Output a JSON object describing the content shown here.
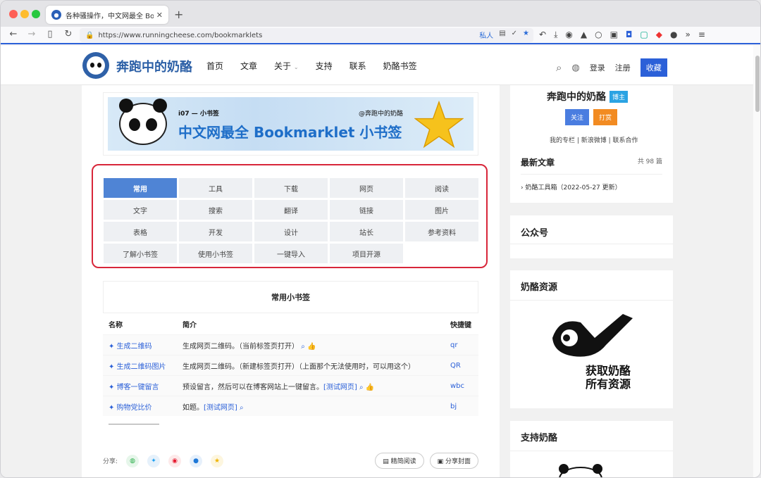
{
  "browser": {
    "tab_title": "各种骚操作，中文网最全 Bookmarklet",
    "url": "https://www.runningcheese.com/bookmarklets",
    "url_private": "私人",
    "accent": "#2b60d8"
  },
  "header": {
    "site_name": "奔跑中的奶酪",
    "menu": [
      "首页",
      "文章",
      "关于",
      "支持",
      "联系",
      "奶酪书签"
    ],
    "login": "登录",
    "register": "注册",
    "favorite": "收藏"
  },
  "banner": {
    "subtitle": "i07 — 小书签",
    "at": "@奔跑中的奶酪",
    "title": "中文网最全 Bookmarklet 小书签"
  },
  "categories": [
    "常用",
    "工具",
    "下载",
    "网页",
    "阅读",
    "文字",
    "搜索",
    "翻译",
    "链接",
    "图片",
    "表格",
    "开发",
    "设计",
    "站长",
    "参考资料",
    "了解小书签",
    "使用小书签",
    "一键导入",
    "项目开源"
  ],
  "section": {
    "title": "常用小书签",
    "columns": [
      "名称",
      "简介",
      "快捷键"
    ],
    "rows": [
      {
        "name": "✦ 生成二维码",
        "desc": "生成网页二维码。（当前标签页打开）",
        "extra": "",
        "key": "qr"
      },
      {
        "name": "✦ 生成二维码图片",
        "desc": "生成网页二维码。（新建标签页打开）（上面那个无法使用时，可以用这个）",
        "extra": "",
        "key": "QR"
      },
      {
        "name": "✦ 博客一键留言",
        "desc": "预设留言，然后可以在博客网站上一键留言。",
        "extra": "[测试网页]",
        "key": "wbc"
      },
      {
        "name": "✦ 购物党比价",
        "desc": "如题。",
        "extra": "[测试网页]",
        "key": "bj"
      }
    ]
  },
  "share": {
    "label": "分享:",
    "read_btn": "精简阅读",
    "cover_btn": "分享封面"
  },
  "sidebar": {
    "profile_name": "奔跑中的奶酪",
    "badge": "博主",
    "follow": "关注",
    "tip": "打赏",
    "links": "我的专栏 | 新浪微博 | 联系合作",
    "latest_title": "最新文章",
    "latest_count": "共 98 篇",
    "latest_item": "奶酪工具箱（2022-05-27 更新）",
    "wechat_title": "公众号",
    "resource_title": "奶酪资源",
    "resource_text1": "获取奶酪",
    "resource_text2": "所有资源",
    "support_title": "支持奶酪"
  }
}
